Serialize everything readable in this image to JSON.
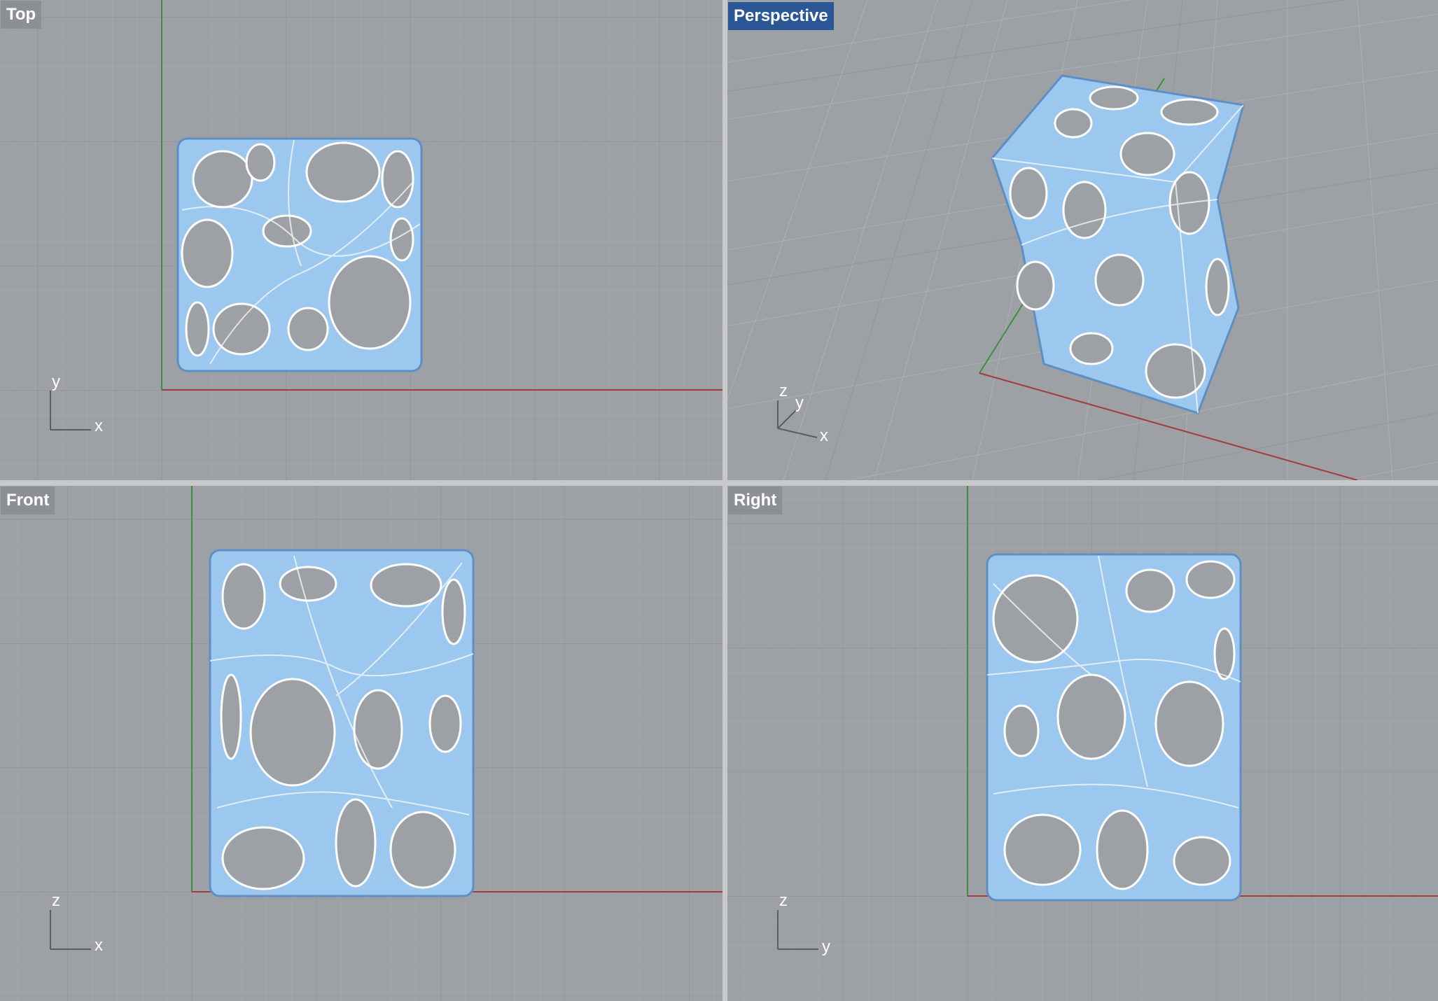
{
  "viewports": {
    "top": {
      "label": "Top",
      "axes": {
        "a": "y",
        "b": "x"
      }
    },
    "persp": {
      "label": "Perspective",
      "axes": {
        "a": "z",
        "b": "y",
        "c": "x"
      }
    },
    "front": {
      "label": "Front",
      "axes": {
        "a": "z",
        "b": "x"
      }
    },
    "right": {
      "label": "Right",
      "axes": {
        "a": "z",
        "b": "y"
      }
    }
  },
  "active_viewport": "Perspective",
  "colors": {
    "grid_background": "#9da1a6",
    "grid_minor": "#a8abaf",
    "grid_major": "#8d9095",
    "x_axis": "#a23c3c",
    "y_axis": "#3f8d3f",
    "object_fill": "#9cc7ef",
    "object_stroke": "#5e8fc4",
    "active_label": "#2b5797",
    "label_bg": "#8c8f93"
  },
  "object": "cellular lattice block"
}
